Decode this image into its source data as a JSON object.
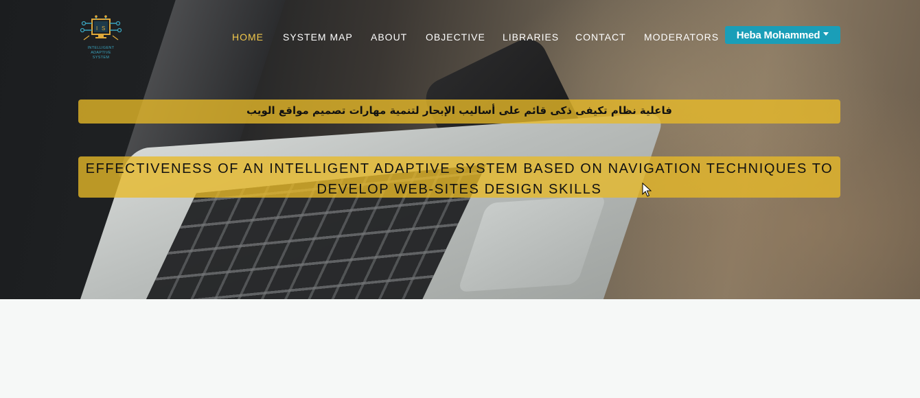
{
  "logo": {
    "alt": "Intelligent Adaptive System logo",
    "lines": [
      "INTELLIGENT",
      "ADAPTIVE",
      "SYSTEM"
    ]
  },
  "nav": {
    "items": [
      {
        "label": "HOME",
        "active": true
      },
      {
        "label": "SYSTEM MAP",
        "active": false
      },
      {
        "label": "ABOUT",
        "active": false
      },
      {
        "label": "OBJECTIVE",
        "active": false
      },
      {
        "label": "LIBRARIES",
        "active": false
      },
      {
        "label": "CONTACT",
        "active": false
      },
      {
        "label": "MODERATORS",
        "active": false
      }
    ]
  },
  "user": {
    "name": "Heba Mohammed",
    "icon": "chevron-down-icon"
  },
  "hero": {
    "title_ar": "فاعلية نظام تكيفى ذكى قائم على أساليب الإبحار لتنمية مهارات تصميم مواقع الويب",
    "title_en": "EFFECTIVENESS OF AN INTELLIGENT ADAPTIVE SYSTEM BASED ON NAVIGATION TECHNIQUES TO DEVELOP WEB-SITES DESIGN SKILLS"
  },
  "colors": {
    "accent": "#f2c84b",
    "banner": "#e8ba28",
    "user_button": "#1a9eb8",
    "page_background": "#f6f8f7"
  }
}
